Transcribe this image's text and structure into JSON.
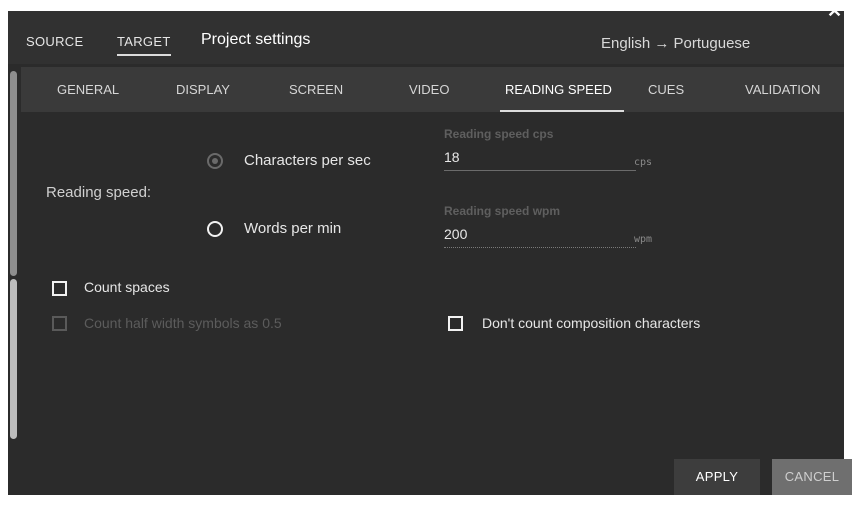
{
  "header": {
    "source_tab": "SOURCE",
    "target_tab": "TARGET",
    "title": "Project settings",
    "language_pair": "English → Portuguese",
    "close_glyph": "✕"
  },
  "tabs": [
    {
      "label": "GENERAL"
    },
    {
      "label": "DISPLAY"
    },
    {
      "label": "SCREEN"
    },
    {
      "label": "VIDEO"
    },
    {
      "label": "READING SPEED",
      "active": true
    },
    {
      "label": "CUES"
    },
    {
      "label": "VALIDATION"
    }
  ],
  "reading_speed": {
    "label": "Reading speed:",
    "options": [
      {
        "label": "Characters per sec",
        "selected": true
      },
      {
        "label": "Words per min",
        "selected": false
      }
    ],
    "cps": {
      "label": "Reading speed cps",
      "value": "18",
      "unit": "cps"
    },
    "wpm": {
      "label": "Reading speed wpm",
      "value": "200",
      "unit": "wpm"
    }
  },
  "checkboxes": {
    "count_spaces": {
      "label": "Count spaces",
      "checked": false,
      "enabled": true
    },
    "count_half_width": {
      "label": "Count half width symbols as 0.5",
      "checked": false,
      "enabled": false
    },
    "dont_count_composition": {
      "label": "Don't count composition characters",
      "checked": false,
      "enabled": true
    }
  },
  "footer": {
    "apply_label": "APPLY",
    "cancel_label": "CANCEL"
  },
  "colors": {
    "dialog_bg": "#2b2b2b",
    "tabbar_bg": "#3a3a3a",
    "disabled_text": "#5c5c5c"
  }
}
